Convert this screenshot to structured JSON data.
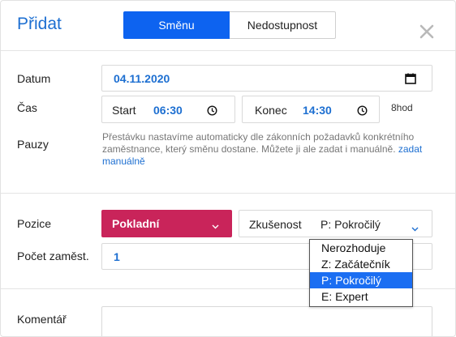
{
  "header": {
    "title": "Přidat",
    "tabs": [
      {
        "label": "Směnu",
        "active": true
      },
      {
        "label": "Nedostupnost",
        "active": false
      }
    ],
    "close_icon": "close-icon"
  },
  "form": {
    "datum": {
      "label": "Datum",
      "value": "04.11.2020",
      "icon": "calendar-icon"
    },
    "cas": {
      "label": "Čas",
      "start_label": "Start",
      "start_value": "06:30",
      "end_label": "Konec",
      "end_value": "14:30",
      "duration": "8hod",
      "icon": "clock-icon"
    },
    "pauzy": {
      "label": "Pauzy",
      "note": "Přestávku nastavíme automaticky dle zákonních požadavků konkrétního zaměstnance, který směnu dostane. Můžete ji ale zadat i manuálně.",
      "link": "zadat manuálně"
    },
    "pozice": {
      "label": "Pozice",
      "value": "Pokladní",
      "color": "#c9245a"
    },
    "zkusenost": {
      "label": "Zkušenost",
      "value": "P: Pokročilý",
      "options": [
        "Nerozhoduje",
        "Z: Začátečník",
        "P: Pokročilý",
        "E: Expert"
      ],
      "selected_index": 2
    },
    "pocet": {
      "label": "Počet zaměst.",
      "value": "1"
    },
    "komentar": {
      "label": "Komentář",
      "value": ""
    }
  },
  "colors": {
    "accent": "#1d6fd1",
    "primary_button": "#0d63f0",
    "position": "#c9245a",
    "selected_option": "#1b6ef2"
  }
}
